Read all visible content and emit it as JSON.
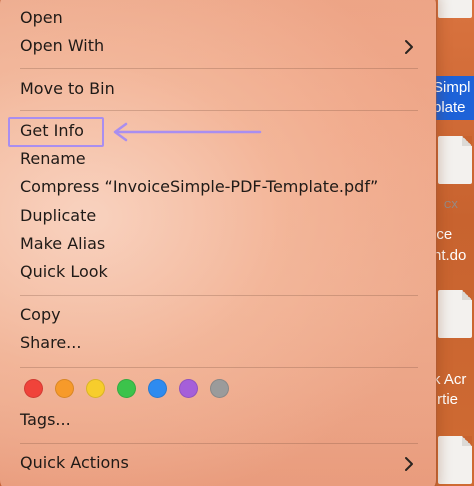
{
  "menu": {
    "items": [
      {
        "label": "Open"
      },
      {
        "label": "Open With"
      },
      {
        "label": "Move to Bin"
      },
      {
        "label": "Get Info"
      },
      {
        "label": "Rename"
      },
      {
        "label": "Compress “InvoiceSimple-PDF-Template.pdf”"
      },
      {
        "label": "Duplicate"
      },
      {
        "label": "Make Alias"
      },
      {
        "label": "Quick Look"
      },
      {
        "label": "Copy"
      },
      {
        "label": "Share..."
      },
      {
        "label": "Tags..."
      },
      {
        "label": "Quick Actions"
      }
    ],
    "tag_colors": [
      "#f0433a",
      "#f79a2a",
      "#f7cd2c",
      "#3cc34b",
      "#2e8bf0",
      "#a55fd9",
      "#9b9b9b"
    ],
    "highlight_color": "#a98ef0"
  },
  "desktop": {
    "labels": [
      "Simpl",
      "plate",
      "ice",
      "nt.do",
      "k Acr",
      ".rtie"
    ],
    "file_type": "CX"
  }
}
